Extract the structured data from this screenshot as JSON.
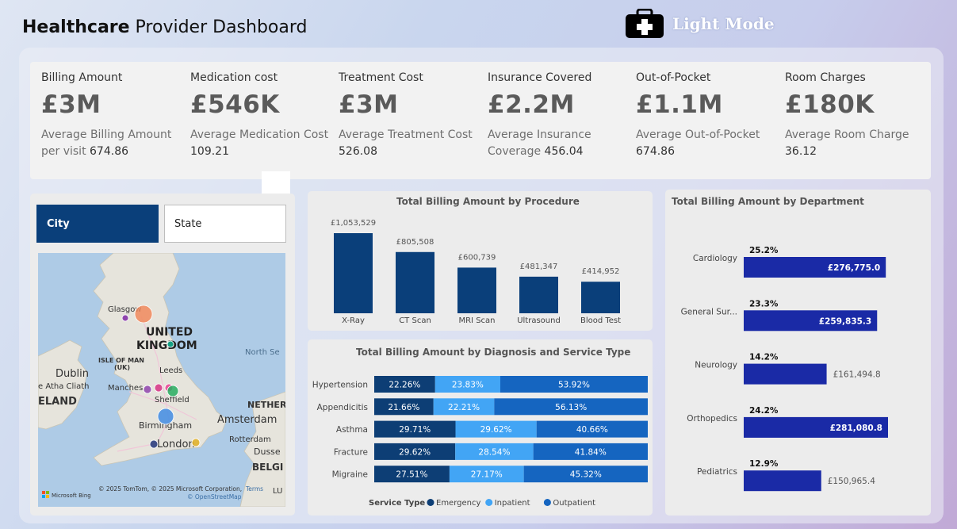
{
  "header": {
    "title_bold": "Healthcare",
    "title_rest": " Provider Dashboard",
    "mode_label": "Light Mode",
    "mode_icon": "medical-briefcase-icon"
  },
  "kpis": [
    {
      "label": "Billing Amount",
      "value": "£3M",
      "sub_text": "Average Billing Amount per visit",
      "sub_value": "674.86"
    },
    {
      "label": "Medication cost",
      "value": "£546K",
      "sub_text": "Average Medication Cost",
      "sub_value": "109.21"
    },
    {
      "label": "Treatment Cost",
      "value": "£3M",
      "sub_text": "Average Treatment Cost",
      "sub_value": "526.08"
    },
    {
      "label": "Insurance Covered",
      "value": "£2.2M",
      "sub_text": "Average Insurance Coverage",
      "sub_value": "456.04"
    },
    {
      "label": "Out-of-Pocket",
      "value": "£1.1M",
      "sub_text": "Average Out-of-Pocket",
      "sub_value": "674.86"
    },
    {
      "label": "Room Charges",
      "value": "£180K",
      "sub_text": "Average Room Charge",
      "sub_value": "36.12"
    }
  ],
  "map": {
    "toggle": {
      "city": "City",
      "state": "State"
    },
    "labels": {
      "country": "UNITED",
      "country2": "KINGDOM",
      "glasgow": "Glasgow",
      "isle": "ISLE OF MAN",
      "uk": "(UK)",
      "dublin": "Dublin",
      "atha": "e Atha Cliath",
      "eland": "ELAND",
      "leeds": "Leeds",
      "manchester": "Manches",
      "sheffield": "Sheffield",
      "birmingham": "Birmingham",
      "london": "London",
      "northsea": "North Se",
      "nether": "NETHER",
      "amsterdam": "Amsterdam",
      "rotterdam": "Rotterdam",
      "dussel": "Dusse",
      "belg": "BELGI",
      "lux": "LU"
    },
    "copyright": "© 2025 TomTom, © 2025 Microsoft Corporation,",
    "terms": "Terms",
    "osm": "© OpenStreetMap",
    "bing": "Microsoft Bing",
    "bubble_colors": [
      "#f08a5d",
      "#8e44ad",
      "#16a085",
      "#d63384",
      "#8e44ad",
      "#e84393",
      "#27ae60",
      "#4a90e2",
      "#e1b12c",
      "#2c3e7f"
    ]
  },
  "chart_data": [
    {
      "type": "bar",
      "title": "Total Billing Amount by Procedure",
      "categories": [
        "X-Ray",
        "CT Scan",
        "MRI Scan",
        "Ultrasound",
        "Blood Test"
      ],
      "values": [
        1053529,
        805508,
        600739,
        481347,
        414952
      ],
      "value_labels": [
        "£1,053,529",
        "£805,508",
        "£600,739",
        "£481,347",
        "£414,952"
      ],
      "color": "#0a3f7a",
      "ylim": [
        0,
        1053529
      ]
    },
    {
      "type": "bar",
      "stacked": "100%",
      "orientation": "horizontal",
      "title": "Total Billing Amount by Diagnosis and Service Type",
      "categories": [
        "Hypertension",
        "Appendicitis",
        "Asthma",
        "Fracture",
        "Migraine"
      ],
      "series": [
        {
          "name": "Emergency",
          "color": "#0d3e75",
          "values": [
            22.26,
            21.66,
            29.71,
            29.62,
            27.51
          ]
        },
        {
          "name": "Inpatient",
          "color": "#42a5f5",
          "values": [
            23.83,
            22.21,
            29.62,
            28.54,
            27.17
          ]
        },
        {
          "name": "Outpatient",
          "color": "#1565c0",
          "values": [
            53.92,
            56.13,
            40.66,
            41.84,
            45.32
          ]
        }
      ],
      "legend_title": "Service Type",
      "legend_position": "bottom"
    },
    {
      "type": "bar",
      "orientation": "horizontal",
      "title": "Total Billing Amount by Department",
      "categories": [
        "Cardiology",
        "General Sur...",
        "Neurology",
        "Orthopedics",
        "Pediatrics"
      ],
      "values": [
        276775.0,
        259835.3,
        161494.8,
        281080.8,
        150965.4
      ],
      "value_labels": [
        "£276,775.0",
        "£259,835.3",
        "£161,494.8",
        "£281,080.8",
        "£150,965.4"
      ],
      "percent_labels": [
        "25.2%",
        "23.3%",
        "14.2%",
        "24.2%",
        "12.9%"
      ],
      "color": "#1a2aa6",
      "xlim": [
        0,
        281080.8
      ]
    }
  ]
}
